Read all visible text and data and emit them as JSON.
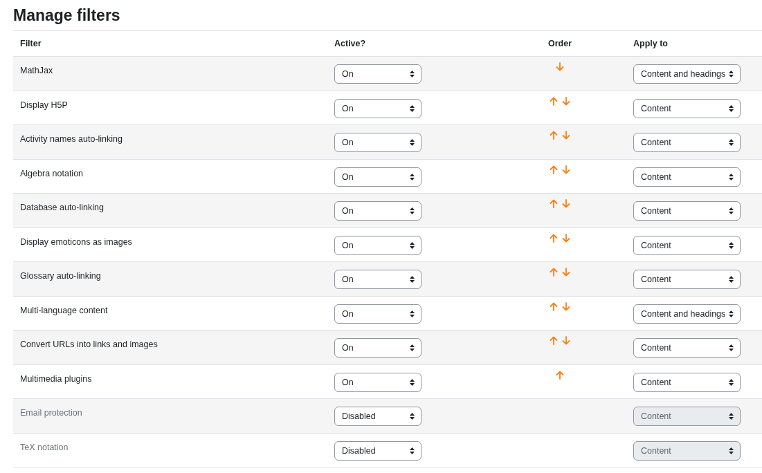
{
  "title": "Manage filters",
  "columns": [
    "Filter",
    "Active?",
    "Order",
    "Apply to"
  ],
  "rows": [
    {
      "name": "MathJax",
      "active": "On",
      "up": false,
      "down": true,
      "apply": "Content and headings",
      "disabled": false
    },
    {
      "name": "Display H5P",
      "active": "On",
      "up": true,
      "down": true,
      "apply": "Content",
      "disabled": false
    },
    {
      "name": "Activity names auto-linking",
      "active": "On",
      "up": true,
      "down": true,
      "apply": "Content",
      "disabled": false
    },
    {
      "name": "Algebra notation",
      "active": "On",
      "up": true,
      "down": true,
      "apply": "Content",
      "disabled": false
    },
    {
      "name": "Database auto-linking",
      "active": "On",
      "up": true,
      "down": true,
      "apply": "Content",
      "disabled": false
    },
    {
      "name": "Display emoticons as images",
      "active": "On",
      "up": true,
      "down": true,
      "apply": "Content",
      "disabled": false
    },
    {
      "name": "Glossary auto-linking",
      "active": "On",
      "up": true,
      "down": true,
      "apply": "Content",
      "disabled": false
    },
    {
      "name": "Multi-language content",
      "active": "On",
      "up": true,
      "down": true,
      "apply": "Content and headings",
      "disabled": false
    },
    {
      "name": "Convert URLs into links and images",
      "active": "On",
      "up": true,
      "down": true,
      "apply": "Content",
      "disabled": false
    },
    {
      "name": "Multimedia plugins",
      "active": "On",
      "up": true,
      "down": false,
      "apply": "Content",
      "disabled": false
    },
    {
      "name": "Email protection",
      "active": "Disabled",
      "up": false,
      "down": false,
      "apply": "Content",
      "disabled": true
    },
    {
      "name": "TeX notation",
      "active": "Disabled",
      "up": false,
      "down": false,
      "apply": "Content",
      "disabled": true
    }
  ]
}
